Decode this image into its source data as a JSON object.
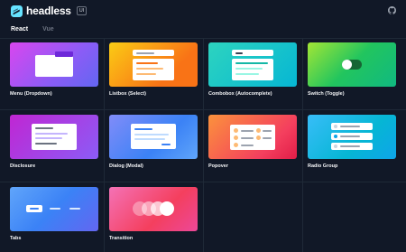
{
  "app": {
    "brand": "headless",
    "version": "UI"
  },
  "tabs": [
    {
      "label": "React",
      "active": true
    },
    {
      "label": "Vue",
      "active": false
    }
  ],
  "components": [
    {
      "label": "Menu (Dropdown)",
      "gradient": "purple"
    },
    {
      "label": "Listbox (Select)",
      "gradient": "orange"
    },
    {
      "label": "Combobox (Autocomplete)",
      "gradient": "teal"
    },
    {
      "label": "Switch (Toggle)",
      "gradient": "green"
    },
    {
      "label": "Disclosure",
      "gradient": "violet"
    },
    {
      "label": "Dialog (Modal)",
      "gradient": "blue"
    },
    {
      "label": "Popover",
      "gradient": "red"
    },
    {
      "label": "Radio Group",
      "gradient": "sky"
    },
    {
      "label": "Tabs",
      "gradient": "indigo"
    },
    {
      "label": "Transition",
      "gradient": "pink"
    }
  ],
  "colors": {
    "background": "#111827",
    "accent": "#06b6d4"
  }
}
